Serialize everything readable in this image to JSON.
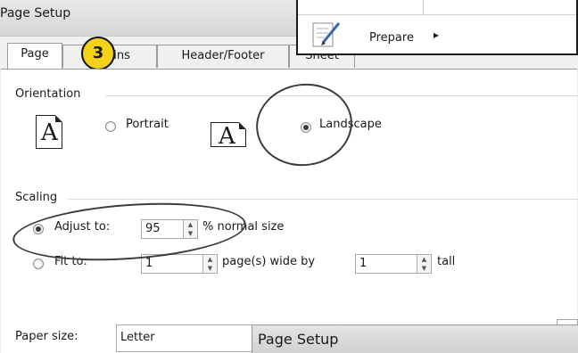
{
  "window": {
    "title": "Page Setup"
  },
  "tabs": [
    {
      "label": "Page"
    },
    {
      "label": "Margins"
    },
    {
      "label": "Header/Footer"
    },
    {
      "label": "Sheet"
    }
  ],
  "tab_overlap_text": "gins",
  "step_badge": "3",
  "menu": {
    "item_label": "Prepare"
  },
  "orientation": {
    "heading": "Orientation",
    "portrait_label": "Portrait",
    "landscape_label": "Landscape",
    "selected": "Landscape",
    "page_glyph": "A"
  },
  "scaling": {
    "heading": "Scaling",
    "adjust_label": "Adjust to:",
    "adjust_value": "95",
    "adjust_suffix": "% normal size",
    "fit_label": "Fit to:",
    "fit_wide_value": "1",
    "fit_wide_suffix": "page(s) wide by",
    "fit_tall_value": "1",
    "fit_tall_suffix": "tall",
    "selected": "Adjust to:"
  },
  "paper": {
    "label": "Paper size:",
    "value": "Letter"
  },
  "overlay_dialog": {
    "title": "Page Setup"
  },
  "icons": {
    "spinner": "spinner-arrows",
    "submenu": "chevron-right-icon",
    "prepare": "prepare-document-icon"
  },
  "colors": {
    "badge": "#f2d21b",
    "annotation_stroke": "#3c3c3c"
  }
}
